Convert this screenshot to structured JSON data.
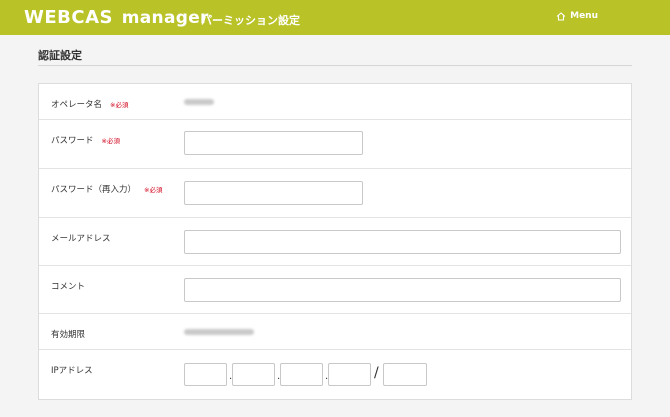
{
  "header": {
    "logo": "WEBCAS",
    "logo_sub": "manager",
    "page": "パーミッション設定",
    "menu": "Menu"
  },
  "section": {
    "title": "認証設定"
  },
  "form": {
    "operator": {
      "label": "オペレータ名",
      "required": "※必須",
      "value": "KJ0002"
    },
    "password": {
      "label": "パスワード",
      "required": "※必須",
      "value": ""
    },
    "password_confirm": {
      "label": "パスワード（再入力）",
      "required": "※必須",
      "value": ""
    },
    "email": {
      "label": "メールアドレス",
      "value": ""
    },
    "comment": {
      "label": "コメント",
      "value": ""
    },
    "expiry": {
      "label": "有効期限",
      "value": "2020/09/01 0:15:00"
    },
    "ip": {
      "label": "IPアドレス",
      "dot": ".",
      "slash": "/"
    }
  },
  "colors": {
    "header_bg": "#b9c227",
    "required": "#d0021b"
  }
}
